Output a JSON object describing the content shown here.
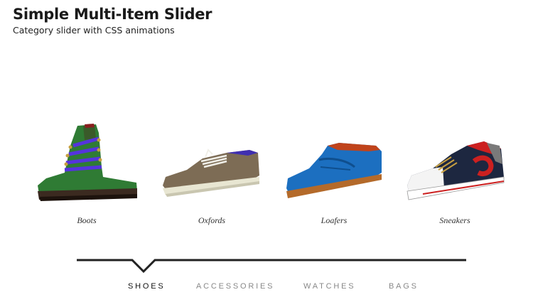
{
  "header": {
    "title": "Simple Multi-Item Slider",
    "subtitle": "Category slider with CSS animations"
  },
  "slides": [
    {
      "label": "Boots",
      "icon": "boot-image"
    },
    {
      "label": "Oxfords",
      "icon": "oxford-shoe-image"
    },
    {
      "label": "Loafers",
      "icon": "loafer-image"
    },
    {
      "label": "Sneakers",
      "icon": "sneaker-image"
    }
  ],
  "nav": {
    "items": [
      {
        "label": "SHOES",
        "active": true
      },
      {
        "label": "ACCESSORIES",
        "active": false
      },
      {
        "label": "WATCHES",
        "active": false
      },
      {
        "label": "BAGS",
        "active": false
      }
    ]
  },
  "colors": {
    "text": "#1a1a1a",
    "track": "#222222",
    "nav_active": "#111111",
    "nav_inactive": "#888888"
  }
}
